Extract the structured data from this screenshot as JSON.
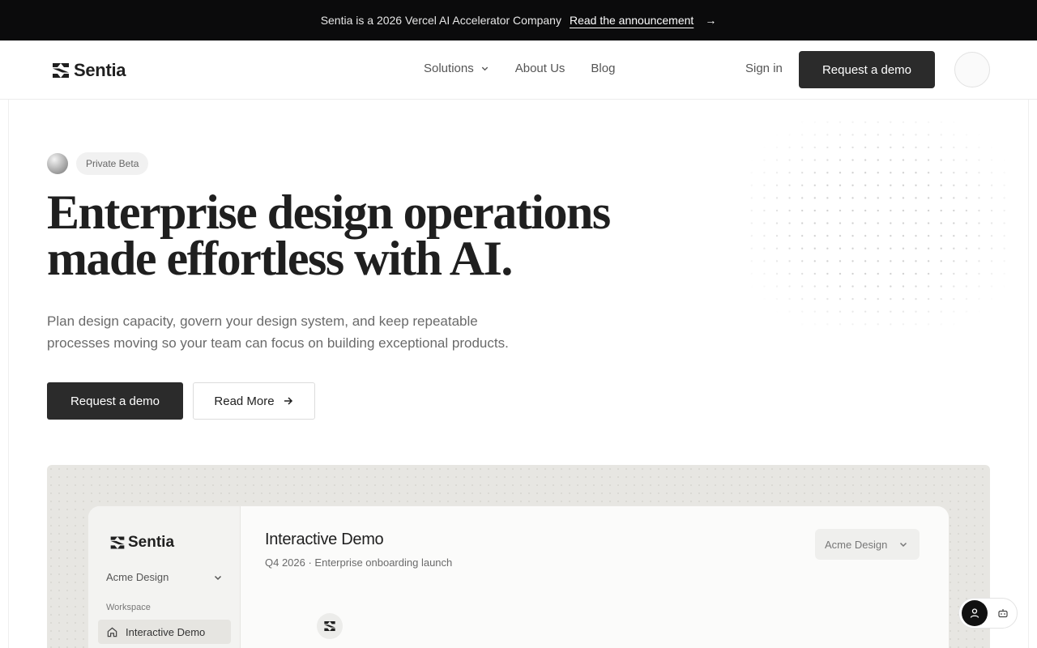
{
  "announcement": {
    "text": "Sentia is a 2026 Vercel AI Accelerator Company",
    "link_label": "Read the announcement",
    "arrow": "→"
  },
  "nav": {
    "brand": "Sentia",
    "links": [
      {
        "label": "Solutions",
        "has_dropdown": true
      },
      {
        "label": "About Us"
      },
      {
        "label": "Blog"
      }
    ],
    "sign_in": "Sign in",
    "cta": "Request a demo"
  },
  "hero": {
    "badge": "Private Beta",
    "title_line1": "Enterprise design operations",
    "title_line2": "made effortless with AI.",
    "subtitle_line1": "Plan design capacity, govern your design system, and keep repeatable",
    "subtitle_line2": "processes moving so your team can focus on building exceptional products.",
    "primary_cta": "Request a demo",
    "secondary_cta": "Read More"
  },
  "demo": {
    "brand": "Sentia",
    "workspace_select": "Acme Design",
    "section_label": "Workspace",
    "active_item": "Interactive Demo",
    "title": "Interactive Demo",
    "subtitle": "Q4 2026 · Enterprise onboarding launch",
    "org_select": "Acme Design"
  },
  "colors": {
    "announcement_bg": "#0b0b0c",
    "primary_button": "#2b2b2b",
    "demo_bg": "#e7e6e2"
  }
}
